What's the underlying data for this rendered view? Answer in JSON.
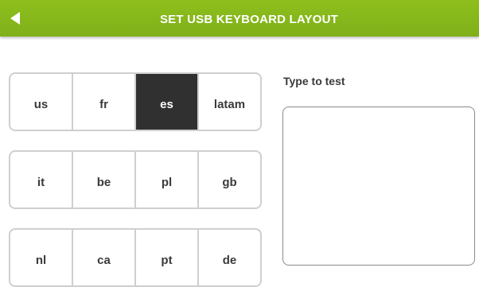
{
  "header": {
    "title": "SET USB KEYBOARD LAYOUT",
    "back_icon": "back-arrow-icon",
    "bar_color": "#86b81b"
  },
  "layouts": {
    "rows": [
      [
        {
          "code": "us",
          "selected": false
        },
        {
          "code": "fr",
          "selected": false
        },
        {
          "code": "es",
          "selected": true
        },
        {
          "code": "latam",
          "selected": false
        }
      ],
      [
        {
          "code": "it",
          "selected": false
        },
        {
          "code": "be",
          "selected": false
        },
        {
          "code": "pl",
          "selected": false
        },
        {
          "code": "gb",
          "selected": false
        }
      ],
      [
        {
          "code": "nl",
          "selected": false
        },
        {
          "code": "ca",
          "selected": false
        },
        {
          "code": "pt",
          "selected": false
        },
        {
          "code": "de",
          "selected": false
        }
      ]
    ]
  },
  "test": {
    "label": "Type to test",
    "value": ""
  }
}
